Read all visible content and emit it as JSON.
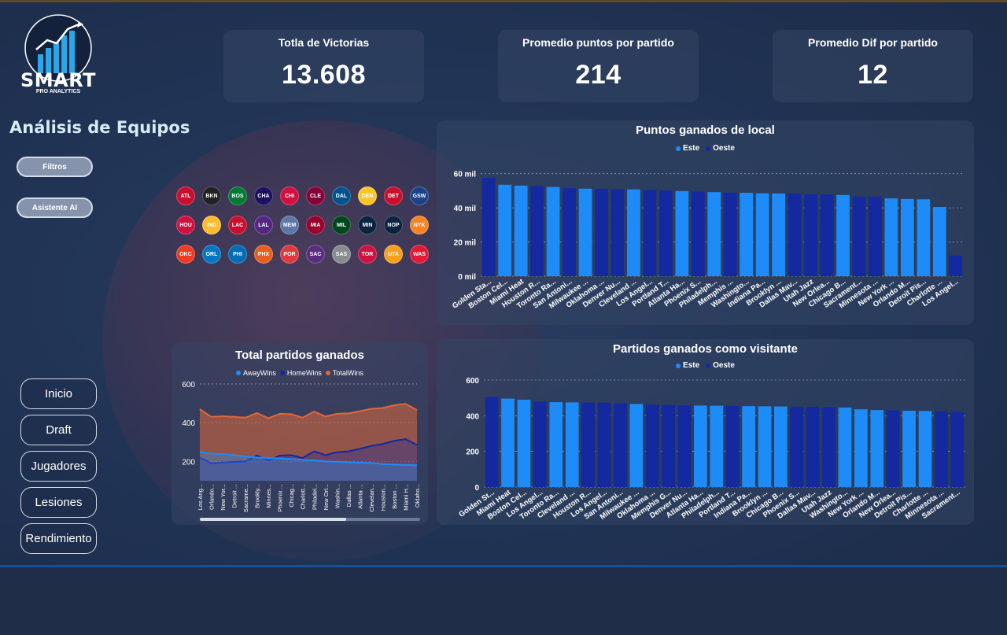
{
  "brand": {
    "name": "SMART",
    "sub": "PRO ANALYTICS"
  },
  "page_title": "Análisis de Equipos",
  "buttons": {
    "filters": "Filtros",
    "assistant": "Asistente AI"
  },
  "nav": [
    "Inicio",
    "Draft",
    "Jugadores",
    "Lesiones",
    "Rendimiento"
  ],
  "kpis": [
    {
      "label": "Totla de Victorias",
      "value": "13.608"
    },
    {
      "label": "Promedio puntos por partido",
      "value": "214"
    },
    {
      "label": "Promedio Dif por partido",
      "value": "12"
    }
  ],
  "teams": [
    {
      "abbr": "ATL",
      "color": "#c8102e"
    },
    {
      "abbr": "BKN",
      "color": "#222222"
    },
    {
      "abbr": "BOS",
      "color": "#007a33"
    },
    {
      "abbr": "CHA",
      "color": "#1d1160"
    },
    {
      "abbr": "CHI",
      "color": "#ce1141"
    },
    {
      "abbr": "CLE",
      "color": "#860038"
    },
    {
      "abbr": "DAL",
      "color": "#00538c"
    },
    {
      "abbr": "DEN",
      "color": "#fec524"
    },
    {
      "abbr": "DET",
      "color": "#c8102e"
    },
    {
      "abbr": "GSW",
      "color": "#1d428a"
    },
    {
      "abbr": "HOU",
      "color": "#ce1141"
    },
    {
      "abbr": "IND",
      "color": "#fdbb30"
    },
    {
      "abbr": "LAC",
      "color": "#c8102e"
    },
    {
      "abbr": "LAL",
      "color": "#552583"
    },
    {
      "abbr": "MEM",
      "color": "#5d76a9"
    },
    {
      "abbr": "MIA",
      "color": "#98002e"
    },
    {
      "abbr": "MIL",
      "color": "#00471b"
    },
    {
      "abbr": "MIN",
      "color": "#0c2340"
    },
    {
      "abbr": "NOP",
      "color": "#0c2340"
    },
    {
      "abbr": "NYK",
      "color": "#f58426"
    },
    {
      "abbr": "OKC",
      "color": "#ef3b24"
    },
    {
      "abbr": "ORL",
      "color": "#0077c0"
    },
    {
      "abbr": "PHI",
      "color": "#006bb6"
    },
    {
      "abbr": "PHX",
      "color": "#e56020"
    },
    {
      "abbr": "POR",
      "color": "#e03a3e"
    },
    {
      "abbr": "SAC",
      "color": "#5a2d81"
    },
    {
      "abbr": "SAS",
      "color": "#8a8d8f"
    },
    {
      "abbr": "TOR",
      "color": "#ce1141"
    },
    {
      "abbr": "UTA",
      "color": "#f9a01b"
    },
    {
      "abbr": "WAS",
      "color": "#e31837"
    }
  ],
  "colors": {
    "este": "#1d8cf8",
    "oeste": "#1428a0",
    "away": "#1d8cf8",
    "home": "#1428a0",
    "total": "#e0673a"
  },
  "chart_data": [
    {
      "type": "bar",
      "title": "Puntos ganados de local",
      "legend": [
        {
          "name": "Este",
          "color": "#1d8cf8"
        },
        {
          "name": "Oeste",
          "color": "#1428a0"
        }
      ],
      "y_ticks": [
        "0 mil",
        "20 mil",
        "40 mil",
        "60 mil"
      ],
      "ylim": [
        0,
        64
      ],
      "grid": true,
      "categories": [
        "Golden Sta...",
        "Boston Cel...",
        "Miami Heat",
        "Houston R...",
        "Toronto Ra...",
        "San Antoni...",
        "Milwaukee ...",
        "Oklahoma ...",
        "Denver Nu...",
        "Cleveland ...",
        "Los Angel...",
        "Portland T...",
        "Atlanta Ha...",
        "Phoenix S...",
        "Philadelph...",
        "Memphis ...",
        "Washingto...",
        "Indiana Pa...",
        "Brooklyn ...",
        "Dallas Mav...",
        "Utah Jazz",
        "New Orlea...",
        "Chicago B...",
        "Sacrament...",
        "Minnesota ...",
        "New York ...",
        "Orlando M...",
        "Detroit Pis...",
        "Charlotte ...",
        "Los Angel..."
      ],
      "values": [
        57.5,
        53.5,
        53.0,
        52.8,
        52.2,
        51.5,
        51.2,
        51.0,
        50.8,
        50.8,
        50.5,
        50.2,
        49.8,
        49.5,
        49.2,
        48.9,
        48.8,
        48.5,
        48.4,
        48.3,
        48.0,
        47.8,
        47.5,
        46.5,
        46.4,
        45.5,
        45.2,
        45.0,
        40.5,
        12.0
      ],
      "groups": [
        "Oeste",
        "Este",
        "Este",
        "Oeste",
        "Este",
        "Oeste",
        "Este",
        "Oeste",
        "Oeste",
        "Este",
        "Oeste",
        "Oeste",
        "Este",
        "Oeste",
        "Este",
        "Oeste",
        "Este",
        "Este",
        "Este",
        "Oeste",
        "Oeste",
        "Oeste",
        "Este",
        "Oeste",
        "Oeste",
        "Este",
        "Este",
        "Este",
        "Este",
        "Oeste"
      ]
    },
    {
      "type": "area",
      "title": "Total partidos ganados",
      "legend": [
        {
          "name": "AwayWins",
          "color": "#1d8cf8"
        },
        {
          "name": "HomeWins",
          "color": "#1428a0"
        },
        {
          "name": "TotalWins",
          "color": "#e0673a"
        }
      ],
      "y_ticks": [
        "200",
        "400",
        "600"
      ],
      "ylim": [
        100,
        620
      ],
      "grid": true,
      "categories": [
        "Los Ang...",
        "Orlando...",
        "New Yor...",
        "Detroit ...",
        "Sacrame...",
        "Brookly...",
        "Minnes...",
        "Phoenix ...",
        "Chicag...",
        "Charlott...",
        "Philadel...",
        "New Orl...",
        "Washin...",
        "Dallas ...",
        "Atlanta ...",
        "Clevelan...",
        "Houston...",
        "Boston ...",
        "Miami H...",
        "Oklaho..."
      ],
      "series": [
        {
          "name": "AwayWins",
          "values": [
            250,
            240,
            238,
            232,
            226,
            220,
            218,
            216,
            212,
            208,
            205,
            200,
            198,
            196,
            194,
            192,
            186,
            184,
            182,
            180
          ]
        },
        {
          "name": "HomeWins",
          "values": [
            220,
            190,
            195,
            198,
            200,
            230,
            205,
            230,
            232,
            218,
            252,
            232,
            248,
            252,
            265,
            280,
            290,
            306,
            315,
            285
          ]
        },
        {
          "name": "TotalWins",
          "values": [
            470,
            430,
            433,
            430,
            426,
            450,
            423,
            446,
            444,
            426,
            457,
            432,
            446,
            448,
            459,
            472,
            476,
            490,
            497,
            465
          ]
        }
      ]
    },
    {
      "type": "bar",
      "title": "Partidos ganados como visitante",
      "legend": [
        {
          "name": "Este",
          "color": "#1d8cf8"
        },
        {
          "name": "Oeste",
          "color": "#1428a0"
        }
      ],
      "y_ticks": [
        "0",
        "200",
        "400",
        "600"
      ],
      "ylim": [
        0,
        600
      ],
      "grid": true,
      "categories": [
        "Golden St...",
        "Miami Heat",
        "Boston Cel...",
        "Los Angel...",
        "Toronto Ra...",
        "Cleveland ...",
        "Houston R...",
        "Los Angel...",
        "San Antoni...",
        "Milwaukee ...",
        "Oklahoma ...",
        "Memphis G...",
        "Denver Nu...",
        "Atlanta Ha...",
        "Philadelph...",
        "Portland T...",
        "Indiana Pa...",
        "Brooklyn ...",
        "Chicago B...",
        "Phoenix S...",
        "Dallas Mav...",
        "Utah Jazz",
        "Washingto...",
        "New York ...",
        "Orlando M...",
        "New Orlea...",
        "Detroit Pis...",
        "Charlotte ...",
        "Minnesota ...",
        "Sacrament..."
      ],
      "values": [
        505,
        496,
        490,
        478,
        476,
        475,
        474,
        473,
        470,
        466,
        463,
        460,
        458,
        457,
        456,
        455,
        454,
        453,
        452,
        451,
        449,
        448,
        446,
        436,
        432,
        430,
        428,
        426,
        424,
        422
      ],
      "groups": [
        "Oeste",
        "Este",
        "Este",
        "Oeste",
        "Este",
        "Este",
        "Oeste",
        "Oeste",
        "Oeste",
        "Este",
        "Oeste",
        "Oeste",
        "Oeste",
        "Este",
        "Este",
        "Oeste",
        "Este",
        "Este",
        "Este",
        "Oeste",
        "Oeste",
        "Oeste",
        "Este",
        "Este",
        "Este",
        "Oeste",
        "Este",
        "Este",
        "Oeste",
        "Oeste"
      ]
    }
  ]
}
